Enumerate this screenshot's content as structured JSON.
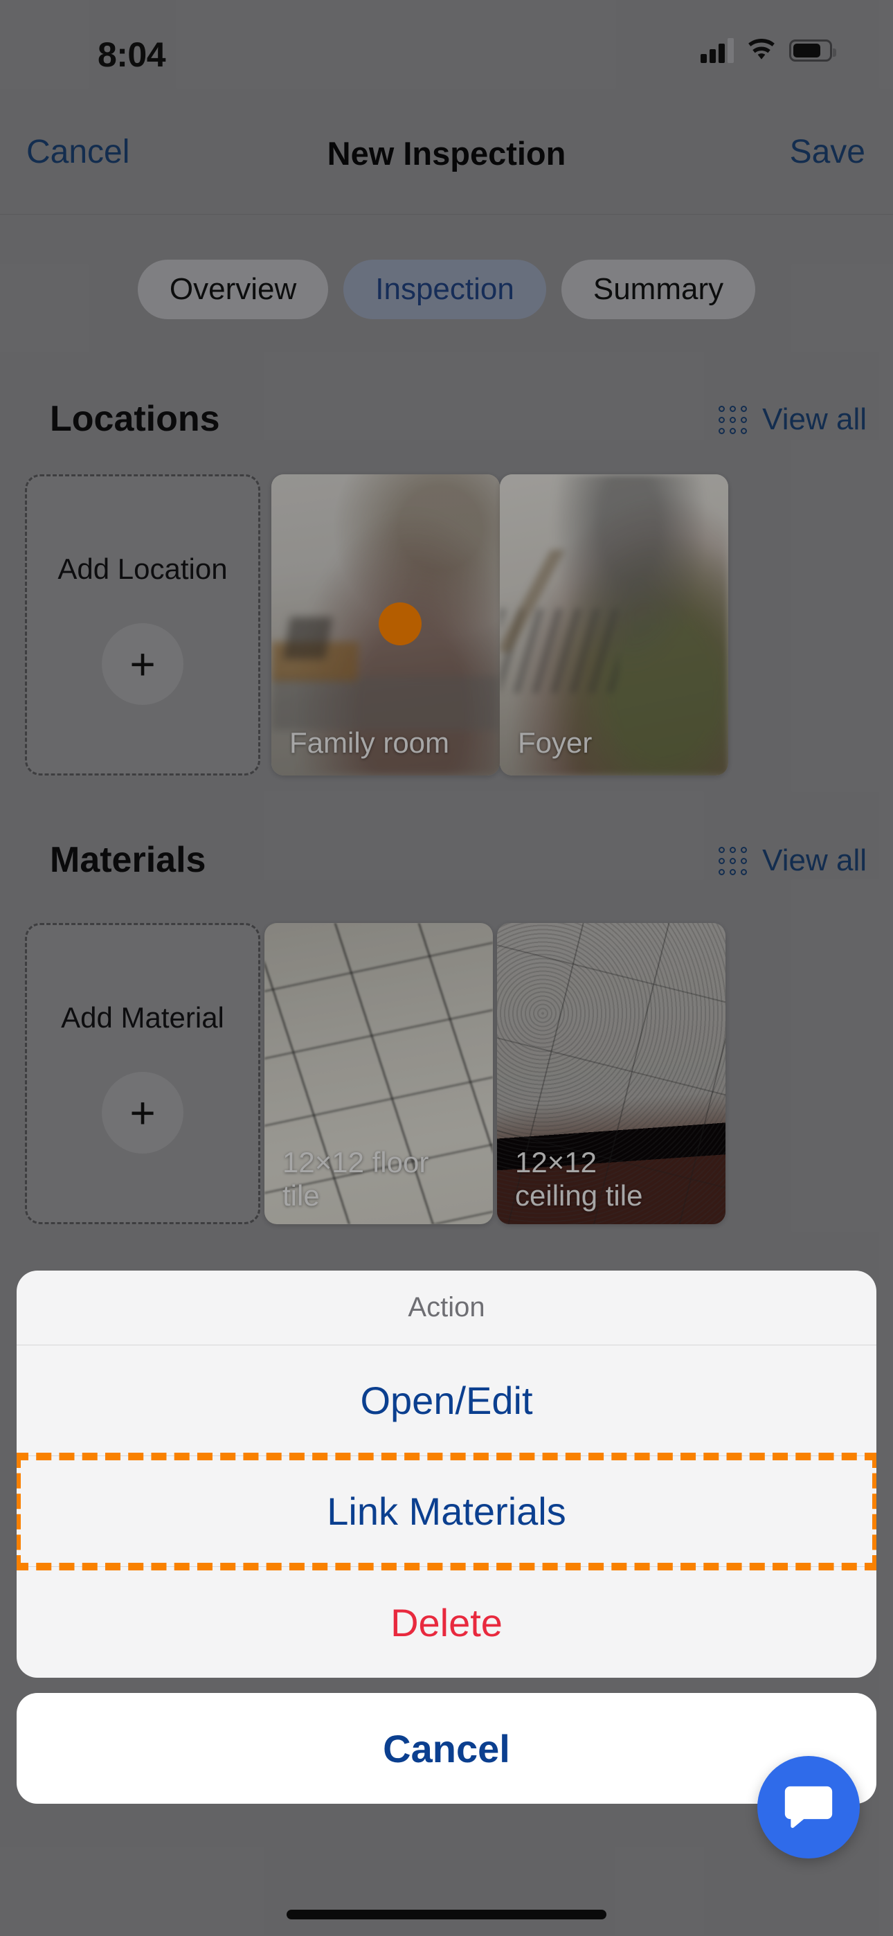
{
  "status_bar": {
    "time": "8:04",
    "cellular_icon": "cellular-signal-icon",
    "wifi_icon": "wifi-icon",
    "battery_icon": "battery-icon"
  },
  "nav_bar": {
    "cancel_label": "Cancel",
    "title": "New Inspection",
    "save_label": "Save"
  },
  "tabs": [
    {
      "label": "Overview",
      "active": false
    },
    {
      "label": "Inspection",
      "active": true
    },
    {
      "label": "Summary",
      "active": false
    }
  ],
  "sections": [
    {
      "title": "Locations",
      "view_all_label": "View all",
      "view_all_icon": "grid-dots-icon",
      "add_card": {
        "label": "Add Location",
        "icon": "plus-icon"
      },
      "cards": [
        {
          "caption": "Family room",
          "has_status_dot": true,
          "status_dot_color": "#fa8200"
        },
        {
          "caption": "Foyer",
          "has_status_dot": false
        }
      ]
    },
    {
      "title": "Materials",
      "view_all_label": "View all",
      "view_all_icon": "grid-dots-icon",
      "add_card": {
        "label": "Add Material",
        "icon": "plus-icon"
      },
      "cards": [
        {
          "caption": "12×12 floor tile",
          "has_status_dot": false
        },
        {
          "caption": "12×12 ceiling tile",
          "has_status_dot": false
        }
      ]
    }
  ],
  "action_sheet": {
    "header": "Action",
    "options": [
      {
        "label": "Open/Edit",
        "style": "default",
        "highlighted": false
      },
      {
        "label": "Link Materials",
        "style": "default",
        "highlighted": true
      },
      {
        "label": "Delete",
        "style": "destructive",
        "highlighted": false
      }
    ],
    "cancel_label": "Cancel",
    "highlight_color": "#f98100"
  },
  "chat_fab": {
    "icon": "chat-bubble-icon",
    "color": "#2f6bea"
  },
  "colors": {
    "accent_blue": "#0b3f8f",
    "nav_link": "#1b3f6e",
    "destructive_red": "#e8293e",
    "status_dot_orange": "#fa8200",
    "highlight_orange": "#f98100"
  }
}
